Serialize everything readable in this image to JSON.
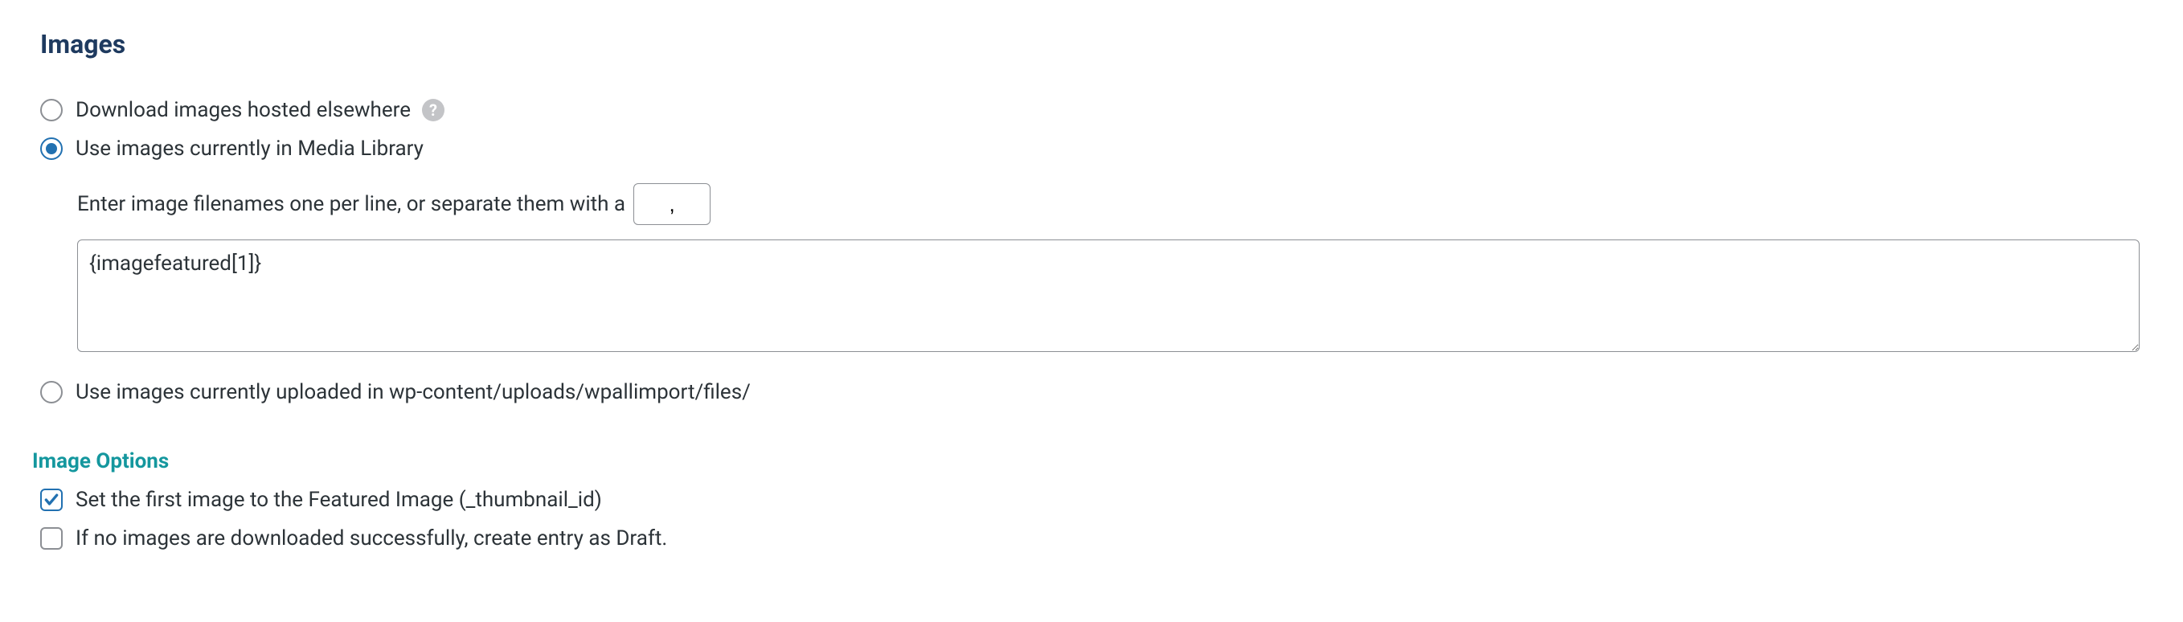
{
  "section_title": "Images",
  "radios": {
    "download": {
      "label": "Download images hosted elsewhere",
      "selected": false
    },
    "media_library": {
      "label": "Use images currently in Media Library",
      "selected": true
    },
    "uploads": {
      "label": "Use images currently uploaded in wp-content/uploads/wpallimport/files/",
      "selected": false
    }
  },
  "filenames_hint": "Enter image filenames one per line, or separate them with a",
  "separator_value": ",",
  "filenames_value": "{imagefeatured[1]}",
  "image_options_title": "Image Options",
  "checkboxes": {
    "featured": {
      "label": "Set the first image to the Featured Image (_thumbnail_id)",
      "checked": true
    },
    "draft": {
      "label": "If no images are downloaded successfully, create entry as Draft.",
      "checked": false
    }
  },
  "help_icon_glyph": "?"
}
